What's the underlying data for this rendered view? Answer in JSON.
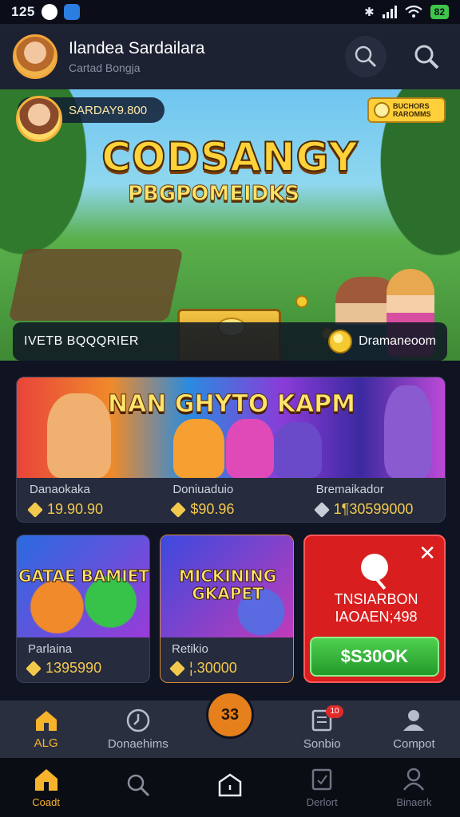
{
  "status_bar": {
    "time": "125",
    "battery": "82"
  },
  "header": {
    "title": "Ilandea Sardailara",
    "subtitle": "Cartad Bongja"
  },
  "hero": {
    "pill_text": "SARDAY9.800",
    "badge_text": "BUCHORS\nRAROMMS",
    "title": "CODSANGY",
    "subtitle": "PBGPOMEIDKS",
    "bar_left": "IVETB BQQQRIER",
    "bar_right": "Dramaneoom"
  },
  "wide_card": {
    "title": "NAN GHYTO KAPM",
    "columns": [
      {
        "label": "Danaokaka",
        "value": "19.90.90"
      },
      {
        "label": "Doniuaduio",
        "value": "$90.96"
      },
      {
        "label": "Bremaikador",
        "value": "1¶30599000"
      }
    ]
  },
  "cards": [
    {
      "art_title": "GATAE BAMIET",
      "label": "Parlaina",
      "value": "1395990"
    },
    {
      "art_title": "MICKINING GKAPET",
      "label": "Retikio",
      "value": "¦.30000"
    }
  ],
  "promo": {
    "text": "TNSIARBON IAOAEN;498",
    "button": "$S30OK"
  },
  "tabs": [
    {
      "label": "ALG",
      "icon": "home-icon",
      "active": true
    },
    {
      "label": "Donaehims",
      "icon": "clock-icon",
      "active": false
    },
    {
      "label": "33",
      "icon": "center-badge",
      "active": false
    },
    {
      "label": "Sonbio",
      "icon": "document-icon",
      "active": false
    },
    {
      "label": "Compot",
      "icon": "profile-icon",
      "active": false
    }
  ],
  "tab_badge": "10",
  "bottom_nav": [
    {
      "label": "Coadt",
      "icon": "home-icon",
      "active": true
    },
    {
      "label": "",
      "icon": "search-icon",
      "active": false
    },
    {
      "label": "",
      "icon": "pentagon-icon",
      "active": false
    },
    {
      "label": "Derlort",
      "icon": "document-icon",
      "active": false
    },
    {
      "label": "Binaerk",
      "icon": "profile-icon",
      "active": false
    }
  ],
  "colors": {
    "accent": "#f7b32b",
    "background": "#0f1322",
    "card": "#262b3d",
    "promo": "#d81e1e",
    "cta": "#35b83a"
  }
}
